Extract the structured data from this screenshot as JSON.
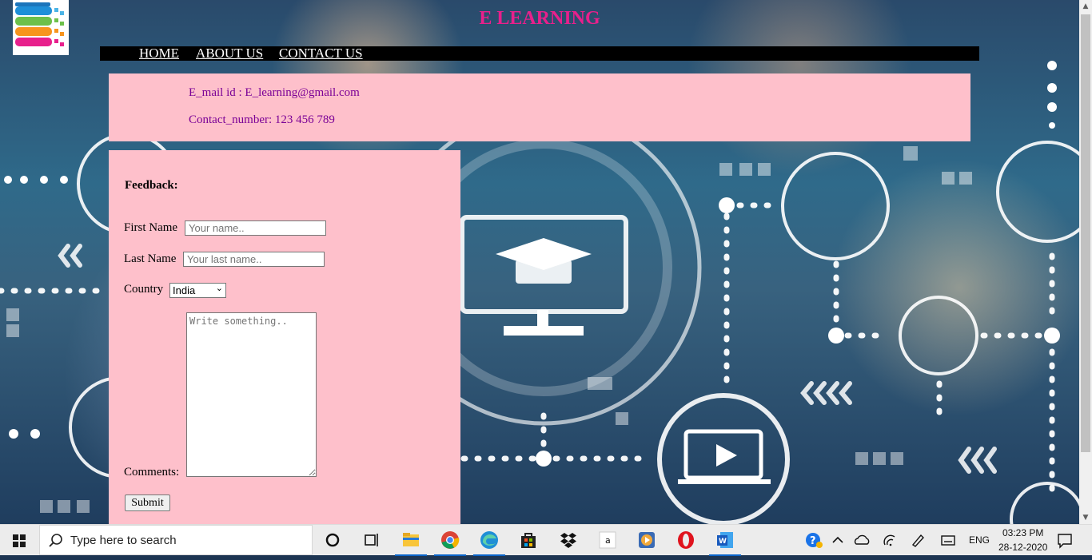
{
  "site": {
    "title": "E LEARNING",
    "nav": [
      "HOME",
      "ABOUT US",
      "CONTACT US"
    ]
  },
  "contact": {
    "email_line": "E_mail id : E_learning@gmail.com",
    "phone_line": "Contact_number: 123 456 789"
  },
  "feedback_form": {
    "heading": "Feedback:",
    "first_name_label": "First Name",
    "first_name_placeholder": "Your name..",
    "last_name_label": "Last Name",
    "last_name_placeholder": "Your last name..",
    "country_label": "Country",
    "country_selected": "India",
    "comments_label": "Comments:",
    "comments_placeholder": "Write something..",
    "submit_label": "Submit"
  },
  "taskbar": {
    "search_placeholder": "Type here to search",
    "apps": [
      "cortana-icon",
      "task-view-icon",
      "file-explorer-icon",
      "chrome-icon",
      "edge-icon",
      "store-icon",
      "dropbox-icon",
      "amazon-icon",
      "media-icon",
      "opera-icon",
      "word-icon"
    ],
    "language": "ENG",
    "time": "03:23 PM",
    "date": "28-12-2020"
  },
  "colors": {
    "title": "#e8208c",
    "panel": "#fec0cb",
    "contact_text": "#7b0096",
    "navbar": "#000000"
  }
}
